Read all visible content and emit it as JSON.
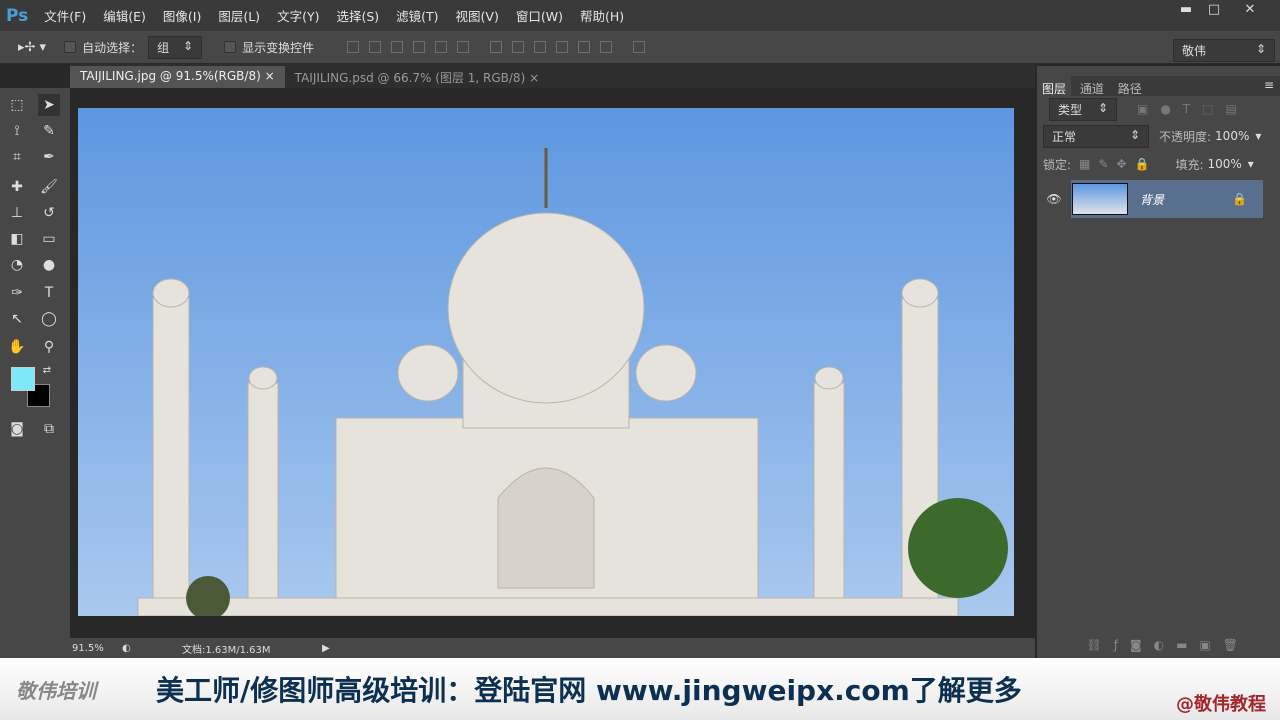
{
  "app": {
    "logo": "Ps"
  },
  "menu": [
    "文件(F)",
    "编辑(E)",
    "图像(I)",
    "图层(L)",
    "文字(Y)",
    "选择(S)",
    "滤镜(T)",
    "视图(V)",
    "窗口(W)",
    "帮助(H)"
  ],
  "window": {
    "minimize": "▬",
    "maximize": "□",
    "close": "✕"
  },
  "options": {
    "auto_select_label": "自动选择：",
    "auto_select_value": "组",
    "show_transform_label": "显示变换控件",
    "workspace": "敬伟"
  },
  "tabs": [
    {
      "label": "TAIJILING.jpg @ 91.5%(RGB/8)",
      "close": "×"
    },
    {
      "label": "TAIJILING.psd @ 66.7% (图层 1, RGB/8)",
      "close": "×"
    }
  ],
  "colors": {
    "foreground": "#7fe8f8",
    "background": "#000000"
  },
  "status": {
    "zoom": "91.5%",
    "doc": "文档:1.63M/1.63M"
  },
  "panel": {
    "tabs": [
      "图层",
      "通道",
      "路径"
    ],
    "filter": "类型",
    "blend": "正常",
    "opacity_label": "不透明度:",
    "opacity": "100%",
    "lock_label": "锁定:",
    "fill_label": "填充:",
    "fill": "100%",
    "layer_name": "背景"
  },
  "banner": {
    "brand": "敬伟培训",
    "text": "美工师/修图师高级培训：登陆官网 www.jingweipx.com了解更多",
    "handle": "@敬伟教程"
  }
}
